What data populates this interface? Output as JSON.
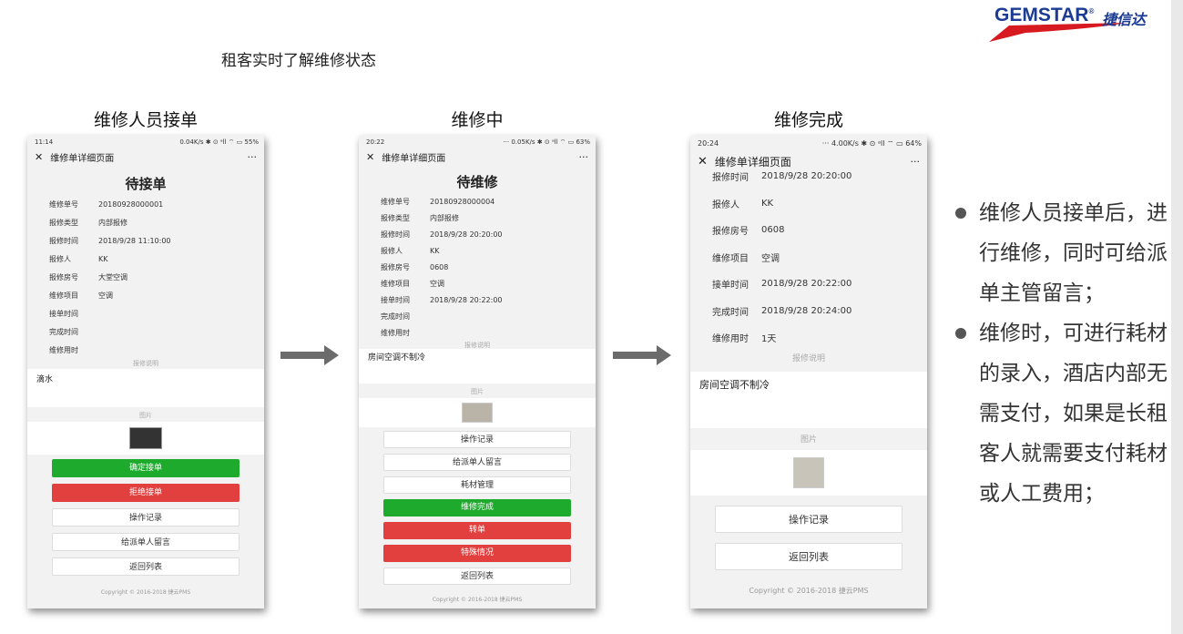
{
  "logo": {
    "brand": "GEMSTAR",
    "mark": "®",
    "cn": "捷信达"
  },
  "slide_title": "租客实时了解维修状态",
  "columns": [
    "维修人员接单",
    "维修中",
    "维修完成"
  ],
  "phone1": {
    "status_time": "11:14",
    "status_right": "0.04K/s ✱ ⊙ ᵃll ⌔ ▭ 55%",
    "nav_title": "维修单详细页面",
    "nav_more": "···",
    "big_title": "待接单",
    "rows": [
      {
        "k": "维修单号",
        "v": "20180928000001"
      },
      {
        "k": "报修类型",
        "v": "内部报修"
      },
      {
        "k": "报修时间",
        "v": "2018/9/28 11:10:00"
      },
      {
        "k": "报修人",
        "v": "KK"
      },
      {
        "k": "报修房号",
        "v": "大堂空调"
      },
      {
        "k": "维修项目",
        "v": "空调"
      },
      {
        "k": "接单时间",
        "v": ""
      },
      {
        "k": "完成时间",
        "v": ""
      },
      {
        "k": "维修用时",
        "v": ""
      }
    ],
    "desc_label": "报修说明",
    "desc": "滴水",
    "img_label": "图片",
    "buttons": [
      "确定接单",
      "拒绝接单",
      "操作记录",
      "给派单人留言",
      "返回列表"
    ],
    "copyright": "Copyright © 2016-2018 捷云PMS"
  },
  "phone2": {
    "status_time": "20:22",
    "status_right": "··· 0.05K/s ✱ ⊙ ᵃll ⌔ ▭ 63%",
    "nav_title": "维修单详细页面",
    "nav_more": "···",
    "big_title": "待维修",
    "rows": [
      {
        "k": "维修单号",
        "v": "20180928000004"
      },
      {
        "k": "报修类型",
        "v": "内部报修"
      },
      {
        "k": "报修时间",
        "v": "2018/9/28 20:20:00"
      },
      {
        "k": "报修人",
        "v": "KK"
      },
      {
        "k": "报修房号",
        "v": "0608"
      },
      {
        "k": "维修项目",
        "v": "空调"
      },
      {
        "k": "接单时间",
        "v": "2018/9/28 20:22:00"
      },
      {
        "k": "完成时间",
        "v": ""
      },
      {
        "k": "维修用时",
        "v": ""
      }
    ],
    "desc_label": "报修说明",
    "desc": "房间空调不制冷",
    "img_label": "图片",
    "buttons": [
      "操作记录",
      "给派单人留言",
      "耗材管理",
      "维修完成",
      "转单",
      "特殊情况",
      "返回列表"
    ],
    "copyright": "Copyright © 2016-2018 捷云PMS"
  },
  "phone3": {
    "status_time": "20:24",
    "status_right": "··· 4.00K/s ✱ ⊙ ᵃll ⌔ ▭ 64%",
    "nav_title": "维修单详细页面",
    "nav_more": "···",
    "rows": [
      {
        "k": "报修时间",
        "v": "2018/9/28 20:20:00"
      },
      {
        "k": "报修人",
        "v": "KK"
      },
      {
        "k": "报修房号",
        "v": "0608"
      },
      {
        "k": "维修项目",
        "v": "空调"
      },
      {
        "k": "接单时间",
        "v": "2018/9/28 20:22:00"
      },
      {
        "k": "完成时间",
        "v": "2018/9/28 20:24:00"
      },
      {
        "k": "维修用时",
        "v": "1天"
      }
    ],
    "desc_label": "报修说明",
    "desc": "房间空调不制冷",
    "img_label": "图片",
    "buttons": [
      "操作记录",
      "返回列表"
    ],
    "copyright": "Copyright © 2016-2018 捷云PMS"
  },
  "bullets": [
    "维修人员接单后，进行维修，同时可给派单主管留言；",
    "维修时，可进行耗材的录入，酒店内部无需支付，如果是长租客人就需要支付耗材或人工费用；"
  ],
  "colors": {
    "green": "#1eaa2d",
    "red": "#e2403f",
    "logo_blue": "#1c3c94",
    "logo_red": "#d71920",
    "arrow": "#6b6b6b"
  }
}
